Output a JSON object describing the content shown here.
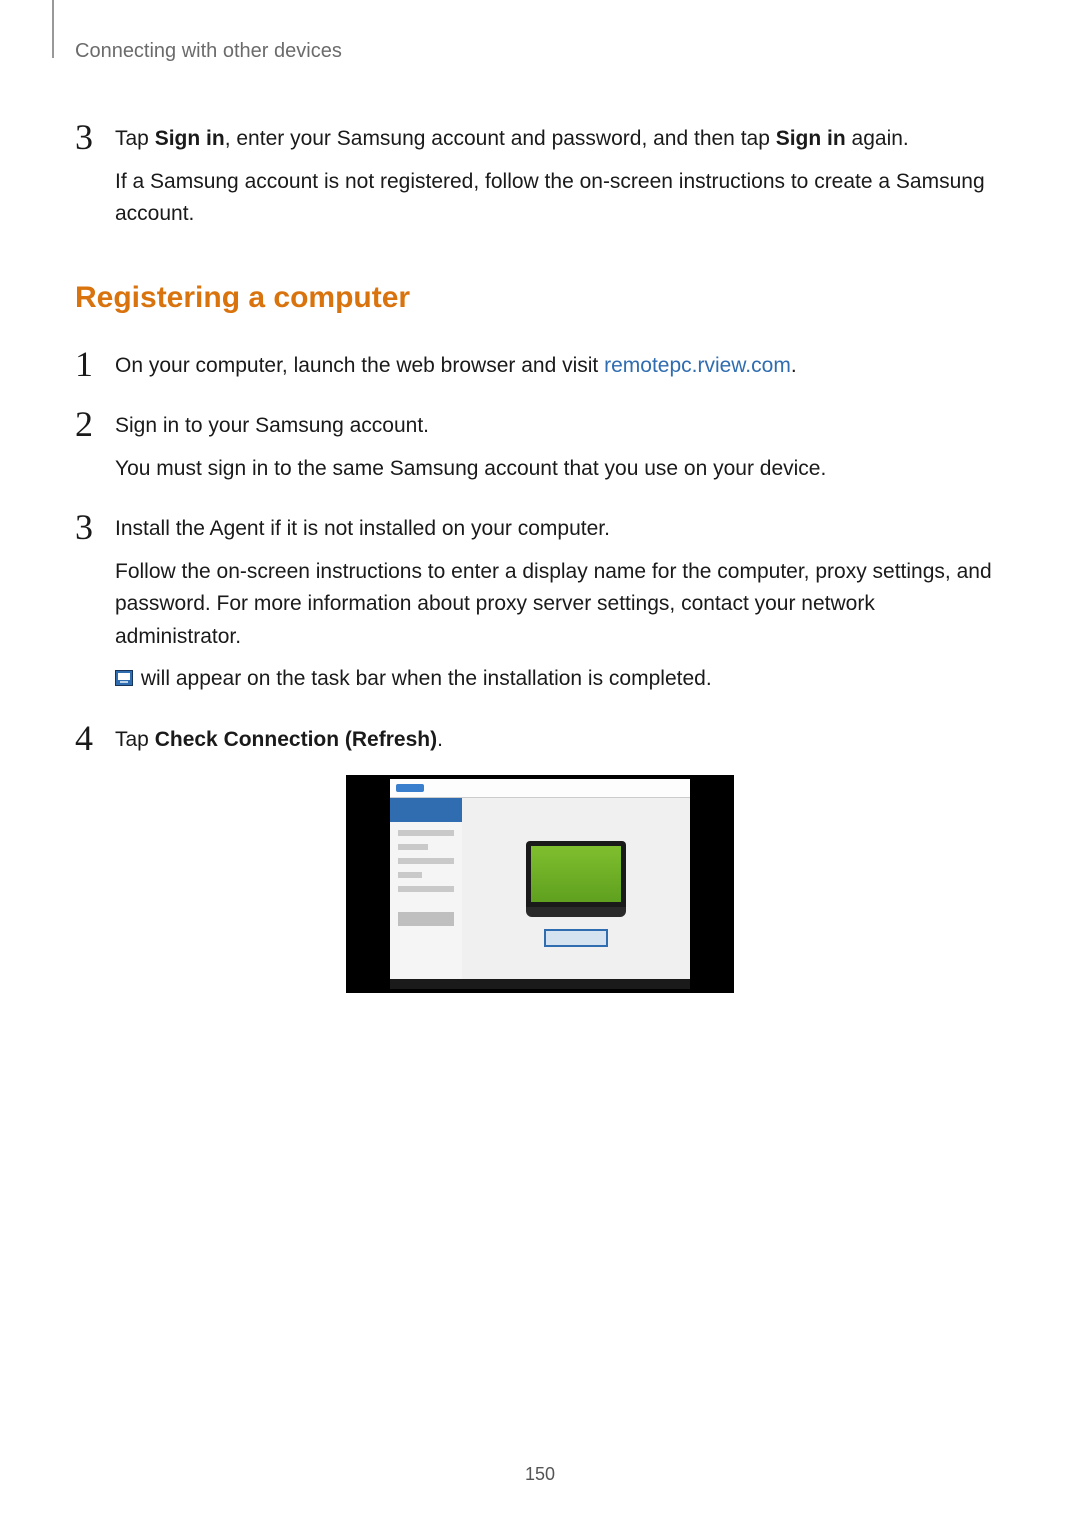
{
  "header": {
    "section_title": "Connecting with other devices"
  },
  "top_step": {
    "number": "3",
    "line1_a": "Tap ",
    "line1_b_bold": "Sign in",
    "line1_c": ", enter your Samsung account and password, and then tap ",
    "line1_d_bold": "Sign in",
    "line1_e": " again.",
    "line2": "If a Samsung account is not registered, follow the on-screen instructions to create a Samsung account."
  },
  "section_heading": "Registering a computer",
  "steps": {
    "s1": {
      "number": "1",
      "line1_a": "On your computer, launch the web browser and visit ",
      "line1_link": "remotepc.rview.com",
      "line1_b": "."
    },
    "s2": {
      "number": "2",
      "line1": "Sign in to your Samsung account.",
      "line2": "You must sign in to the same Samsung account that you use on your device."
    },
    "s3": {
      "number": "3",
      "line1": "Install the Agent if it is not installed on your computer.",
      "line2": "Follow the on-screen instructions to enter a display name for the computer, proxy settings, and password. For more information about proxy server settings, contact your network administrator.",
      "line3": " will appear on the task bar when the installation is completed."
    },
    "s4": {
      "number": "4",
      "line1_a": "Tap ",
      "line1_b_bold": "Check Connection (Refresh)",
      "line1_c": "."
    }
  },
  "page_number": "150"
}
